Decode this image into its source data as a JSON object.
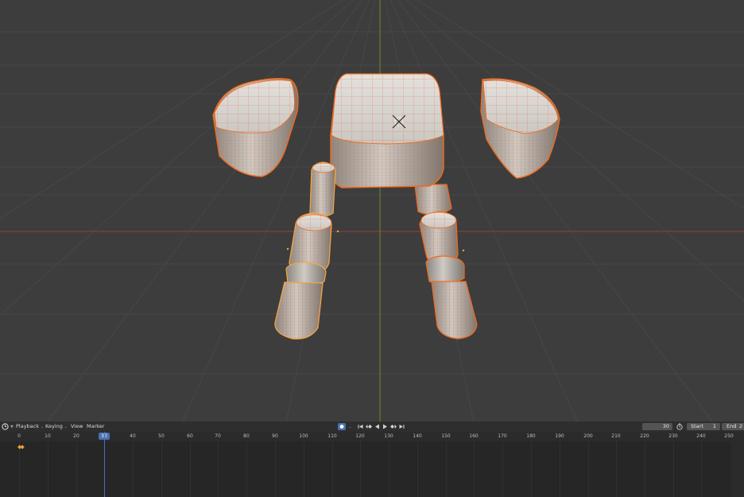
{
  "timeline": {
    "editor_type_icon": "clock-icon",
    "menu": {
      "playback": "Playback",
      "keying": "Keying",
      "view": "View",
      "marker": "Marker"
    },
    "transport": {
      "record_icon": "record-icon",
      "jump_start_icon": "jump-to-start-icon",
      "prev_keyframe_icon": "previous-keyframe-icon",
      "play_reverse_icon": "play-reverse-icon",
      "play_icon": "play-icon",
      "next_keyframe_icon": "next-keyframe-icon",
      "jump_end_icon": "jump-to-end-icon"
    },
    "frame_current": "30",
    "start_label": "Start",
    "start_value": "1",
    "end_label": "End",
    "end_value": "2",
    "current_frame_marker": "30",
    "ruler_ticks": [
      "0",
      "10",
      "20",
      "30",
      "40",
      "50",
      "60",
      "70",
      "80",
      "90",
      "100",
      "110",
      "120",
      "130",
      "140",
      "150",
      "160",
      "170",
      "180",
      "190",
      "200",
      "210",
      "220",
      "230",
      "240",
      "250"
    ]
  },
  "colors": {
    "viewport_bg": "#3d3d3d",
    "timeline_bg": "#262626",
    "selection_outline": "#f06a1c",
    "active_outline": "#f5a742",
    "x_axis": "#9a3b3b",
    "y_axis": "#6b8a2b",
    "accent_blue": "#4772b3"
  }
}
